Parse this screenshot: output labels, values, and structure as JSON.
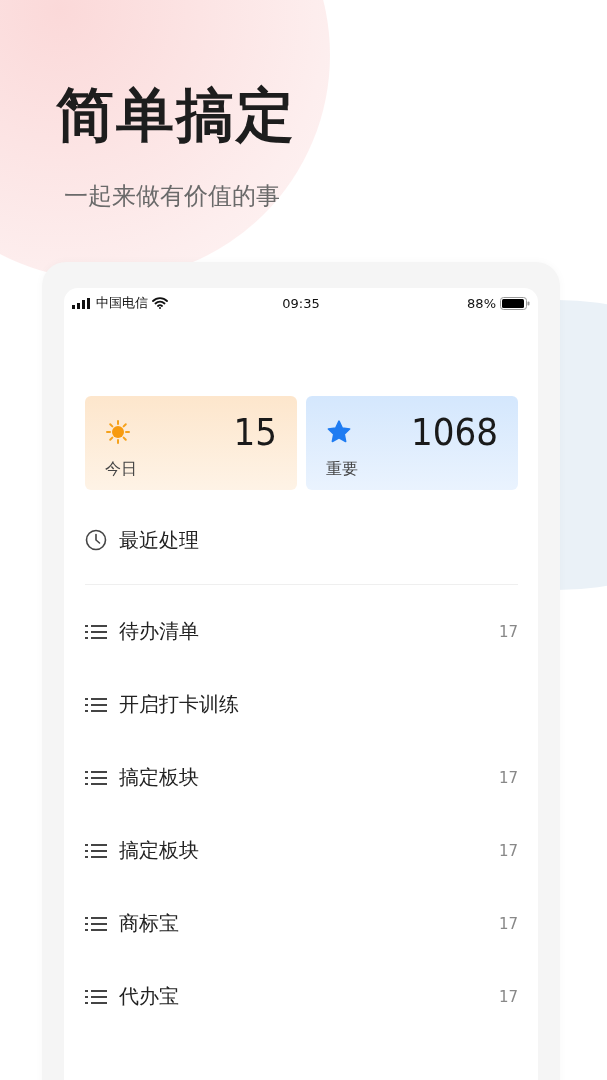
{
  "headline": "简单搞定",
  "tagline": "一起来做有价值的事",
  "status_bar": {
    "carrier": "中国电信",
    "time": "09:35",
    "battery": "88%"
  },
  "summary_cards": [
    {
      "kind": "today",
      "label": "今日",
      "count": "15"
    },
    {
      "kind": "important",
      "label": "重要",
      "count": "1068"
    }
  ],
  "recent": {
    "label": "最近处理"
  },
  "lists": [
    {
      "name": "待办清单",
      "count": "17"
    },
    {
      "name": "开启打卡训练"
    },
    {
      "name": "搞定板块",
      "count": "17"
    },
    {
      "name": "搞定板块",
      "count": "17"
    },
    {
      "name": "商标宝",
      "count": "17"
    },
    {
      "name": "代办宝",
      "count": "17"
    }
  ]
}
